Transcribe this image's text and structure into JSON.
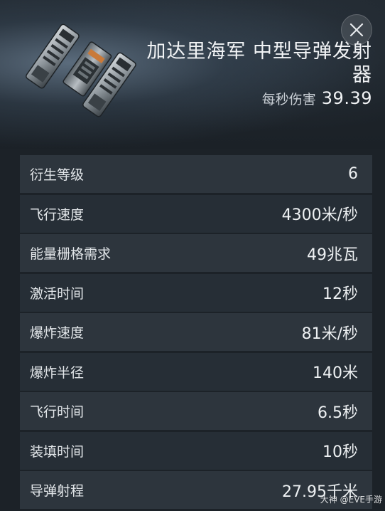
{
  "item": {
    "name": "加达里海军 中型导弹发射器",
    "dps_label": "每秒伤害",
    "dps_value": "39.39"
  },
  "icons": {
    "close": "close-icon",
    "item": "missile-launcher-icon"
  },
  "stats": [
    {
      "label": "衍生等级",
      "value": "6"
    },
    {
      "label": "飞行速度",
      "value": "4300米/秒"
    },
    {
      "label": "能量栅格需求",
      "value": "49兆瓦"
    },
    {
      "label": "激活时间",
      "value": "12秒"
    },
    {
      "label": "爆炸速度",
      "value": "81米/秒"
    },
    {
      "label": "爆炸半径",
      "value": "140米"
    },
    {
      "label": "飞行时间",
      "value": "6.5秒"
    },
    {
      "label": "装填时间",
      "value": "10秒"
    },
    {
      "label": "导弹射程",
      "value": "27.95千米"
    }
  ],
  "watermark": "大神 @EVE手游"
}
